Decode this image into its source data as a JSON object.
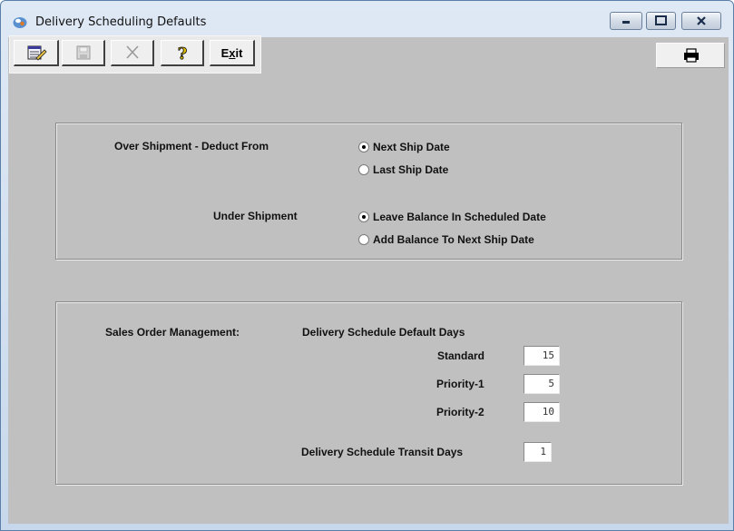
{
  "window": {
    "title": "Delivery Scheduling Defaults"
  },
  "toolbar": {
    "exit_label": "Exit"
  },
  "over_shipment": {
    "label": "Over Shipment - Deduct From",
    "options": [
      {
        "label": "Next Ship Date",
        "selected": true
      },
      {
        "label": "Last Ship Date",
        "selected": false
      }
    ]
  },
  "under_shipment": {
    "label": "Under Shipment",
    "options": [
      {
        "label": "Leave Balance In Scheduled Date",
        "selected": true
      },
      {
        "label": "Add Balance To Next Ship Date",
        "selected": false
      }
    ]
  },
  "sales_order": {
    "section_label": "Sales Order Management:",
    "default_days_label": "Delivery Schedule Default Days",
    "standard_label": "Standard",
    "standard_value": "15",
    "priority1_label": "Priority-1",
    "priority1_value": "5",
    "priority2_label": "Priority-2",
    "priority2_value": "10",
    "transit_label": "Delivery Schedule Transit Days",
    "transit_value": "1"
  }
}
